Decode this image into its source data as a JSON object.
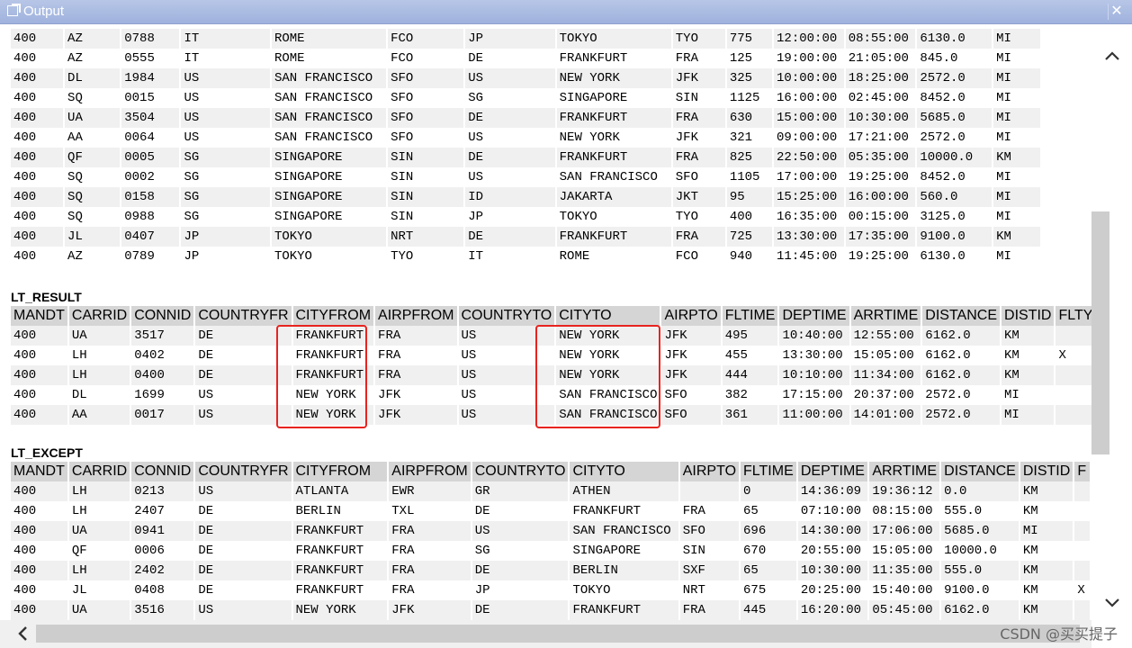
{
  "window": {
    "title": "Output",
    "close_glyph": "✕"
  },
  "top_table": {
    "rows": [
      [
        "400",
        "AZ",
        "0788",
        "IT",
        "ROME",
        "FCO",
        "JP",
        "TOKYO",
        "TYO",
        "775",
        "12:00:00",
        "08:55:00",
        "6130.0",
        "MI"
      ],
      [
        "400",
        "AZ",
        "0555",
        "IT",
        "ROME",
        "FCO",
        "DE",
        "FRANKFURT",
        "FRA",
        "125",
        "19:00:00",
        "21:05:00",
        "845.0",
        "MI"
      ],
      [
        "400",
        "DL",
        "1984",
        "US",
        "SAN FRANCISCO",
        "SFO",
        "US",
        "NEW YORK",
        "JFK",
        "325",
        "10:00:00",
        "18:25:00",
        "2572.0",
        "MI"
      ],
      [
        "400",
        "SQ",
        "0015",
        "US",
        "SAN FRANCISCO",
        "SFO",
        "SG",
        "SINGAPORE",
        "SIN",
        "1125",
        "16:00:00",
        "02:45:00",
        "8452.0",
        "MI"
      ],
      [
        "400",
        "UA",
        "3504",
        "US",
        "SAN FRANCISCO",
        "SFO",
        "DE",
        "FRANKFURT",
        "FRA",
        "630",
        "15:00:00",
        "10:30:00",
        "5685.0",
        "MI"
      ],
      [
        "400",
        "AA",
        "0064",
        "US",
        "SAN FRANCISCO",
        "SFO",
        "US",
        "NEW YORK",
        "JFK",
        "321",
        "09:00:00",
        "17:21:00",
        "2572.0",
        "MI"
      ],
      [
        "400",
        "QF",
        "0005",
        "SG",
        "SINGAPORE",
        "SIN",
        "DE",
        "FRANKFURT",
        "FRA",
        "825",
        "22:50:00",
        "05:35:00",
        "10000.0",
        "KM"
      ],
      [
        "400",
        "SQ",
        "0002",
        "SG",
        "SINGAPORE",
        "SIN",
        "US",
        "SAN FRANCISCO",
        "SFO",
        "1105",
        "17:00:00",
        "19:25:00",
        "8452.0",
        "MI"
      ],
      [
        "400",
        "SQ",
        "0158",
        "SG",
        "SINGAPORE",
        "SIN",
        "ID",
        "JAKARTA",
        "JKT",
        "95",
        "15:25:00",
        "16:00:00",
        "560.0",
        "MI"
      ],
      [
        "400",
        "SQ",
        "0988",
        "SG",
        "SINGAPORE",
        "SIN",
        "JP",
        "TOKYO",
        "TYO",
        "400",
        "16:35:00",
        "00:15:00",
        "3125.0",
        "MI"
      ],
      [
        "400",
        "JL",
        "0407",
        "JP",
        "TOKYO",
        "NRT",
        "DE",
        "FRANKFURT",
        "FRA",
        "725",
        "13:30:00",
        "17:35:00",
        "9100.0",
        "KM"
      ],
      [
        "400",
        "AZ",
        "0789",
        "JP",
        "TOKYO",
        "TYO",
        "IT",
        "ROME",
        "FCO",
        "940",
        "11:45:00",
        "19:25:00",
        "6130.0",
        "MI"
      ]
    ]
  },
  "lt_result": {
    "title": "LT_RESULT",
    "headers": [
      "MANDT",
      "CARRID",
      "CONNID",
      "COUNTRYFR",
      "CITYFROM",
      "AIRPFROM",
      "COUNTRYTO",
      "CITYTO",
      "AIRPTO",
      "FLTIME",
      "DEPTIME",
      "ARRTIME",
      "DISTANCE",
      "DISTID",
      "FLTYP"
    ],
    "rows": [
      [
        "400",
        "UA",
        "3517",
        "DE",
        "FRANKFURT",
        "FRA",
        "US",
        "NEW YORK",
        "JFK",
        "495",
        "10:40:00",
        "12:55:00",
        "6162.0",
        "KM",
        ""
      ],
      [
        "400",
        "LH",
        "0402",
        "DE",
        "FRANKFURT",
        "FRA",
        "US",
        "NEW YORK",
        "JFK",
        "455",
        "13:30:00",
        "15:05:00",
        "6162.0",
        "KM",
        "X"
      ],
      [
        "400",
        "LH",
        "0400",
        "DE",
        "FRANKFURT",
        "FRA",
        "US",
        "NEW YORK",
        "JFK",
        "444",
        "10:10:00",
        "11:34:00",
        "6162.0",
        "KM",
        ""
      ],
      [
        "400",
        "DL",
        "1699",
        "US",
        "NEW YORK",
        "JFK",
        "US",
        "SAN FRANCISCO",
        "SFO",
        "382",
        "17:15:00",
        "20:37:00",
        "2572.0",
        "MI",
        ""
      ],
      [
        "400",
        "AA",
        "0017",
        "US",
        "NEW YORK",
        "JFK",
        "US",
        "SAN FRANCISCO",
        "SFO",
        "361",
        "11:00:00",
        "14:01:00",
        "2572.0",
        "MI",
        ""
      ]
    ]
  },
  "lt_except": {
    "title": "LT_EXCEPT",
    "headers": [
      "MANDT",
      "CARRID",
      "CONNID",
      "COUNTRYFR",
      "CITYFROM",
      "AIRPFROM",
      "COUNTRYTO",
      "CITYTO",
      "AIRPTO",
      "FLTIME",
      "DEPTIME",
      "ARRTIME",
      "DISTANCE",
      "DISTID",
      "F"
    ],
    "rows": [
      [
        "400",
        "LH",
        "0213",
        "US",
        "ATLANTA",
        "EWR",
        "GR",
        "ATHEN",
        "",
        "0",
        "14:36:09",
        "19:36:12",
        "0.0",
        "KM",
        ""
      ],
      [
        "400",
        "LH",
        "2407",
        "DE",
        "BERLIN",
        "TXL",
        "DE",
        "FRANKFURT",
        "FRA",
        "65",
        "07:10:00",
        "08:15:00",
        "555.0",
        "KM",
        ""
      ],
      [
        "400",
        "UA",
        "0941",
        "DE",
        "FRANKFURT",
        "FRA",
        "US",
        "SAN FRANCISCO",
        "SFO",
        "696",
        "14:30:00",
        "17:06:00",
        "5685.0",
        "MI",
        ""
      ],
      [
        "400",
        "QF",
        "0006",
        "DE",
        "FRANKFURT",
        "FRA",
        "SG",
        "SINGAPORE",
        "SIN",
        "670",
        "20:55:00",
        "15:05:00",
        "10000.0",
        "KM",
        ""
      ],
      [
        "400",
        "LH",
        "2402",
        "DE",
        "FRANKFURT",
        "FRA",
        "DE",
        "BERLIN",
        "SXF",
        "65",
        "10:30:00",
        "11:35:00",
        "555.0",
        "KM",
        ""
      ],
      [
        "400",
        "JL",
        "0408",
        "DE",
        "FRANKFURT",
        "FRA",
        "JP",
        "TOKYO",
        "NRT",
        "675",
        "20:25:00",
        "15:40:00",
        "9100.0",
        "KM",
        "X"
      ],
      [
        "400",
        "UA",
        "3516",
        "US",
        "NEW YORK",
        "JFK",
        "DE",
        "FRANKFURT",
        "FRA",
        "445",
        "16:20:00",
        "05:45:00",
        "6162.0",
        "KM",
        ""
      ]
    ]
  },
  "watermark": "CSDN @买买提子",
  "icons": {
    "title": "output-icon",
    "close": "close-icon",
    "up": "chevron-up-icon",
    "down": "chevron-down-icon",
    "left": "chevron-left-icon"
  },
  "colors": {
    "titlebar": "#a9bae2",
    "highlight": "#e8231f",
    "header_bg": "#d5d5d5",
    "row_alt": "#f0f0f0"
  }
}
